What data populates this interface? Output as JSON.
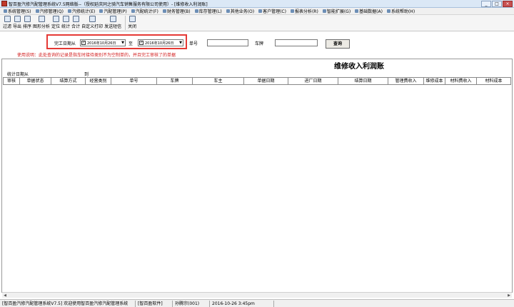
{
  "window": {
    "title": "智百盈汽修汽配管理系统V7.5网络版--（授权延庆同之骑汽车销售服务有限公司使用）- [维修收入利润账]",
    "minimize": "_",
    "maximize": "□",
    "close": "×"
  },
  "menu": [
    {
      "label": "系统管理(S)"
    },
    {
      "label": "汽修管理(Q)"
    },
    {
      "label": "汽修统计(E)"
    },
    {
      "label": "汽配管理(P)"
    },
    {
      "label": "汽配统计(F)"
    },
    {
      "label": "财务管理(B)"
    },
    {
      "label": "库存管理(L)"
    },
    {
      "label": "其他业务(O)"
    },
    {
      "label": "客户管理(C)"
    },
    {
      "label": "报表分析(R)"
    },
    {
      "label": "智能扩展(G)"
    },
    {
      "label": "基础数据(A)"
    },
    {
      "label": "系统帮助(H)"
    }
  ],
  "toolbar": [
    {
      "label": "过滤"
    },
    {
      "label": "导出"
    },
    {
      "label": "排序"
    },
    {
      "label": "图形分析"
    },
    {
      "label": "定位"
    },
    {
      "label": "统计"
    },
    {
      "label": "合计"
    },
    {
      "label": "自定义打印"
    },
    {
      "label": "发送短信"
    },
    {
      "label": "关闭"
    }
  ],
  "filter": {
    "completion_label": "完工日期从",
    "date_from": "2016年10月26日",
    "to_label": "至",
    "date_to": "2016年10月26日",
    "order_no_label": "单号",
    "order_no_value": "",
    "plate_label": "车牌",
    "plate_value": "",
    "query_button": "查询"
  },
  "notice": "使用说明：此处查询的记录是指车时接待类别不为空制单的，并且完工审核了的单据",
  "report": {
    "title": "维修收入利润账",
    "stat_period_label": "统计日期从",
    "stat_to_label": "到"
  },
  "columns": [
    {
      "label": "审核"
    },
    {
      "label": "单据状态"
    },
    {
      "label": "结算方式"
    },
    {
      "label": "经营类别"
    },
    {
      "label": "单号"
    },
    {
      "label": "车牌"
    },
    {
      "label": "车主"
    },
    {
      "label": "单据日期"
    },
    {
      "label": "进厂日期"
    },
    {
      "label": "结算日期"
    },
    {
      "label": "管理费收入"
    },
    {
      "label": "维修成本"
    },
    {
      "label": "材料费收入"
    },
    {
      "label": "材料成本"
    }
  ],
  "status_bar": {
    "welcome": "[智百盈汽修汽配管理系统V7.5] 欢迎使用智百盈汽修汽配管理系统",
    "company": "[智百盈软件]",
    "user": "孙腾宗(001)",
    "datetime": "2016-10-26 3:45pm"
  },
  "colors": {
    "highlight_border": "#e53935",
    "notice_text": "#d21c1c"
  }
}
